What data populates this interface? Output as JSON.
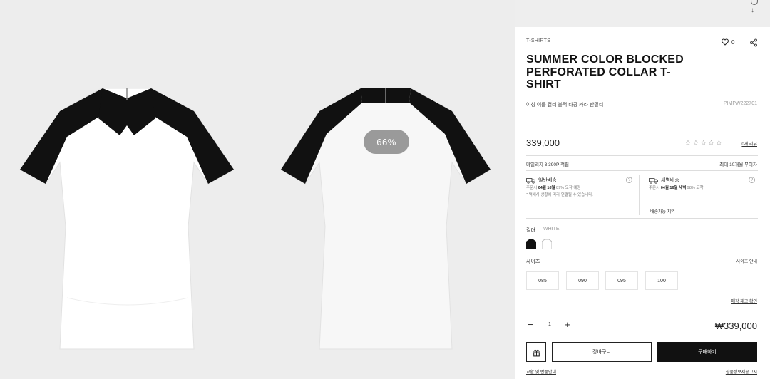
{
  "gallery": {
    "zoom_label": "66%"
  },
  "product": {
    "category": "T-SHIRTS",
    "like_count": "0",
    "title": "SUMMER COLOR BLOCKED PERFORATED COLLAR T-SHIRT",
    "subtitle": "여성 여름 컬러 블럭 타공 카라 반팔티",
    "code": "PIMPW222701",
    "price": "339,000",
    "stars": "☆☆☆☆☆",
    "review_link": "0개 리뷰",
    "mileage": "마일리지 3,390P 적립",
    "installment_link": "최대 10개월 무이자"
  },
  "shipping": {
    "standard": {
      "title": "일반배송",
      "line1_prefix": "주문시 ",
      "line1_bold": "04월 16일",
      "line1_suffix": " 89% 도착 예정",
      "line2": "* 택배사 상황에 따라 연결될 수 있습니다."
    },
    "dawn": {
      "title": "새벽배송",
      "line1_prefix": "주문시 ",
      "line1_bold": "04월 16일 새벽",
      "line1_suffix": " 98% 도착",
      "area_link": "배송가능 지역"
    }
  },
  "options": {
    "color_label": "컬러",
    "color_value": "WHITE",
    "size_label": "사이즈",
    "size_guide_link": "사이즈 안내",
    "sizes": [
      "085",
      "090",
      "095",
      "100"
    ],
    "stock_check_link": "매장 재고 확인"
  },
  "order": {
    "minus": "−",
    "quantity": "1",
    "plus": "+",
    "total": "₩339,000",
    "cart_label": "장바구니",
    "buy_label": "구매하기",
    "exchange_link": "교환 및 반품안내",
    "notice_link": "상품정보제공고시"
  },
  "colors": {
    "primary": "#111111",
    "secondary": "#ffffff",
    "badge": "#9a9a9a"
  }
}
